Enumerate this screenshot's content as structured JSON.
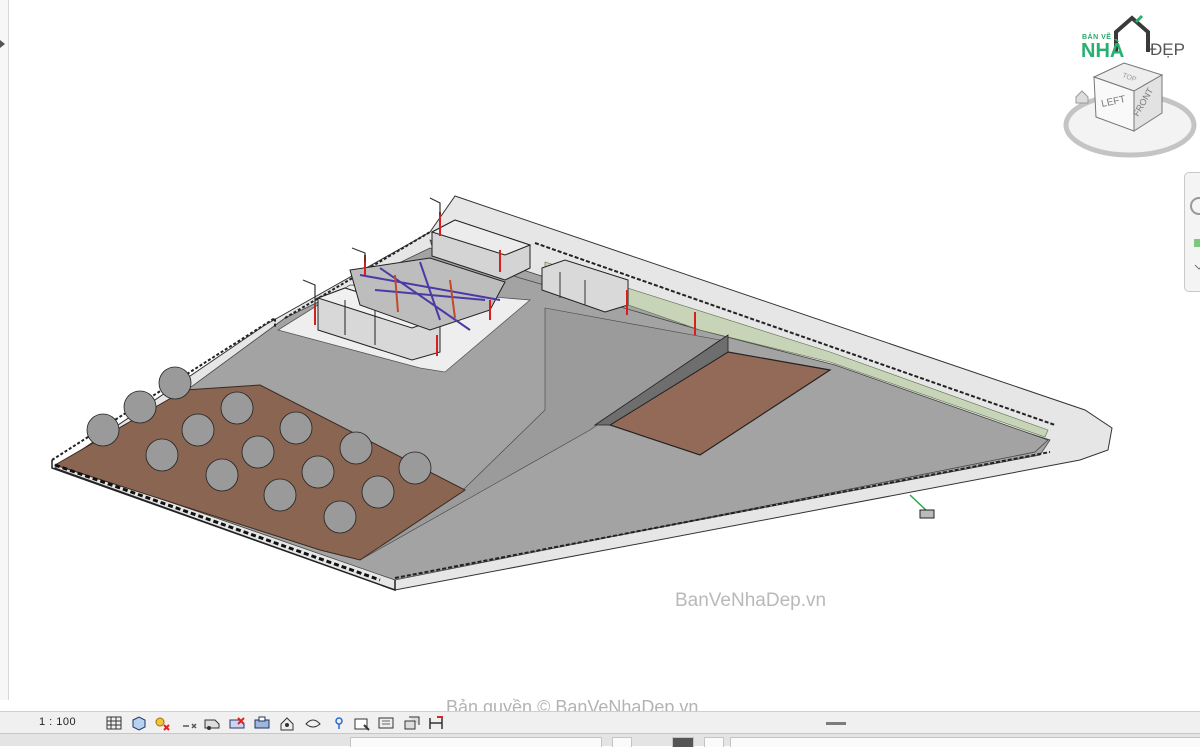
{
  "logo": {
    "top_text": "BẢN VẼ",
    "main_text": "NHÀ",
    "suffix_text": "ĐẸP"
  },
  "viewcube": {
    "top": "TOP",
    "left": "LEFT",
    "front": "FRONT"
  },
  "watermark": "BanVeNhaDep.vn",
  "copyright": "Bản quyền © BanVeNhaDep.vn",
  "view_control_bar": {
    "scale": "1 : 100",
    "buttons": [
      "detail-level-icon",
      "visual-style-icon",
      "sun-path-icon",
      "shadows-icon",
      "render-icon",
      "crop-view-icon",
      "show-crop-region-icon",
      "unlock-3d-view-icon",
      "temporary-hide-icon",
      "reveal-hidden-icon",
      "worksharing-display-icon",
      "analytical-model-icon",
      "highlight-displacement-icon",
      "show-constraints-icon"
    ]
  },
  "colors": {
    "background": "#ffffff",
    "bar": "#f0f0f0",
    "brand_green": "#27b06e",
    "soil": "#8a6552",
    "pavement": "#a2a2a2",
    "wall_marker": "#d62020"
  }
}
